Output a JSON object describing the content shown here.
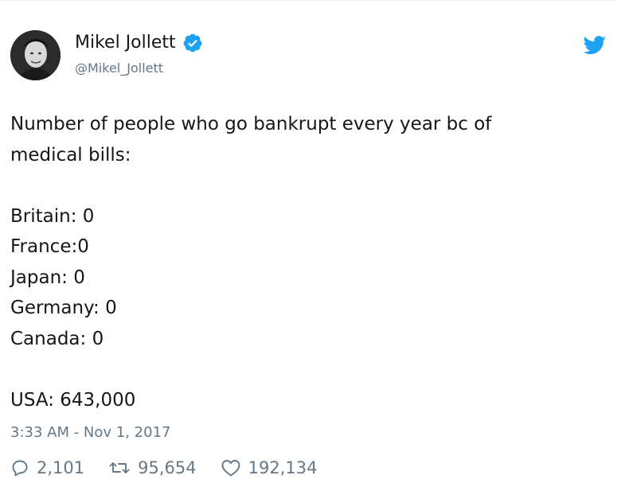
{
  "author": {
    "display_name": "Mikel Jollett",
    "handle": "@Mikel_Jollett",
    "verified": true
  },
  "tweet": {
    "lines": [
      "Number of people who go bankrupt every year bc of",
      "medical bills:",
      "",
      "Britain: 0",
      "France:0",
      "Japan: 0",
      "Germany: 0",
      "Canada: 0",
      "",
      "USA: 643,000"
    ],
    "timestamp": "3:33 AM - Nov 1, 2017"
  },
  "stats": {
    "replies": "2,101",
    "retweets": "95,654",
    "likes": "192,134"
  },
  "colors": {
    "brand": "#1da1f2",
    "text": "#14171a",
    "secondary": "#657786"
  },
  "icons": {
    "verified": "verified-badge-icon",
    "logo": "twitter-bird-icon",
    "reply": "reply-icon",
    "retweet": "retweet-icon",
    "like": "heart-icon"
  }
}
